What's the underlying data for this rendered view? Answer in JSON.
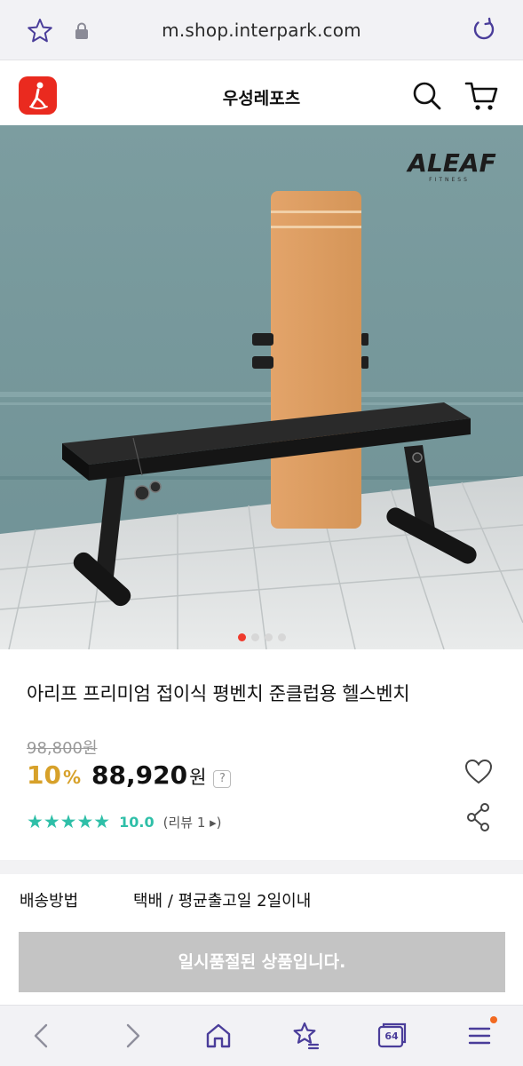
{
  "browser": {
    "url": "m.shop.interpark.com"
  },
  "header": {
    "store_name": "우성레포츠"
  },
  "gallery": {
    "brand_logo_text": "ALEAF",
    "brand_logo_sub": "FITNESS",
    "slide_count": 4,
    "active_slide": 1
  },
  "product": {
    "title": "아리프 프리미엄 접이식 평벤치 준클럽용 헬스벤치",
    "original_price": "98,800원",
    "discount": "10",
    "discount_unit": "%",
    "sale_price": "88,920",
    "currency": "원",
    "help_label": "?",
    "stars": "★★★★★",
    "score": "10.0",
    "reviews": "(리뷰 1 ▸)"
  },
  "shipping": {
    "label": "배송방법",
    "value": "택배 / 평균출고일 2일이내"
  },
  "actions": {
    "soldout_label": "일시품절된 상품입니다."
  },
  "bottom_nav": {
    "tab_count": "64"
  },
  "colors": {
    "accent": "#ea2a1f",
    "discount": "#d7a12a",
    "rating": "#2fbfa8",
    "browser_icon": "#4a3d9a"
  }
}
